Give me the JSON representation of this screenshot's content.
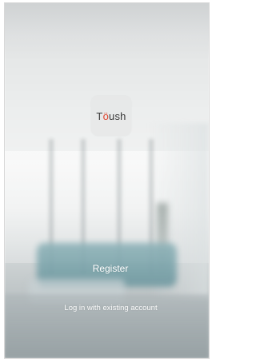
{
  "brand": {
    "logo_before": "T",
    "logo_accent": "ö",
    "logo_after": "ush",
    "accent_color": "#e0452f"
  },
  "actions": {
    "register_label": "Register",
    "login_label": "Log in with existing account"
  },
  "background": {
    "icon": "living-room-photo"
  }
}
